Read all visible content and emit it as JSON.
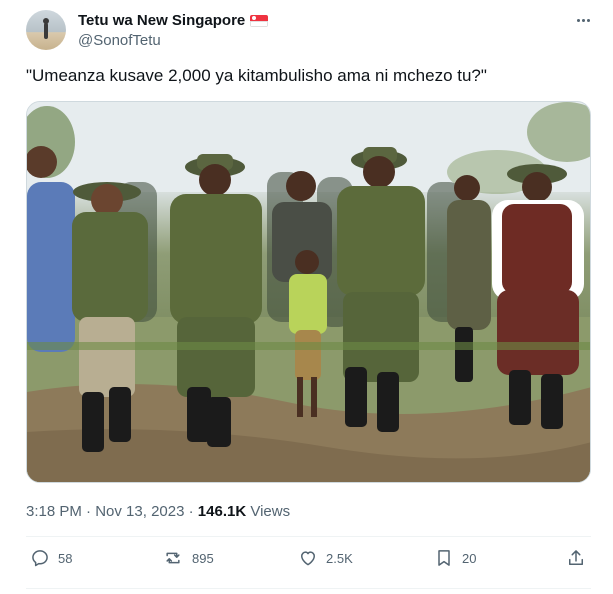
{
  "author": {
    "display_name": "Tetu wa New Singapore",
    "handle": "@SonofTetu",
    "flag_icon": "singapore-flag-icon"
  },
  "tweet": {
    "text": "\"Umeanza kusave 2,000 ya kitambulisho ama ni mchezo tu?\"",
    "time": "3:18 PM",
    "separator": "·",
    "date": "Nov 13, 2023",
    "views_count": "146.1K",
    "views_label": "Views"
  },
  "actions": {
    "replies": "58",
    "retweets": "895",
    "likes": "2.5K",
    "bookmarks": "20"
  },
  "colors": {
    "text_primary": "#0f1419",
    "text_secondary": "#536471",
    "border": "#eff3f4"
  }
}
